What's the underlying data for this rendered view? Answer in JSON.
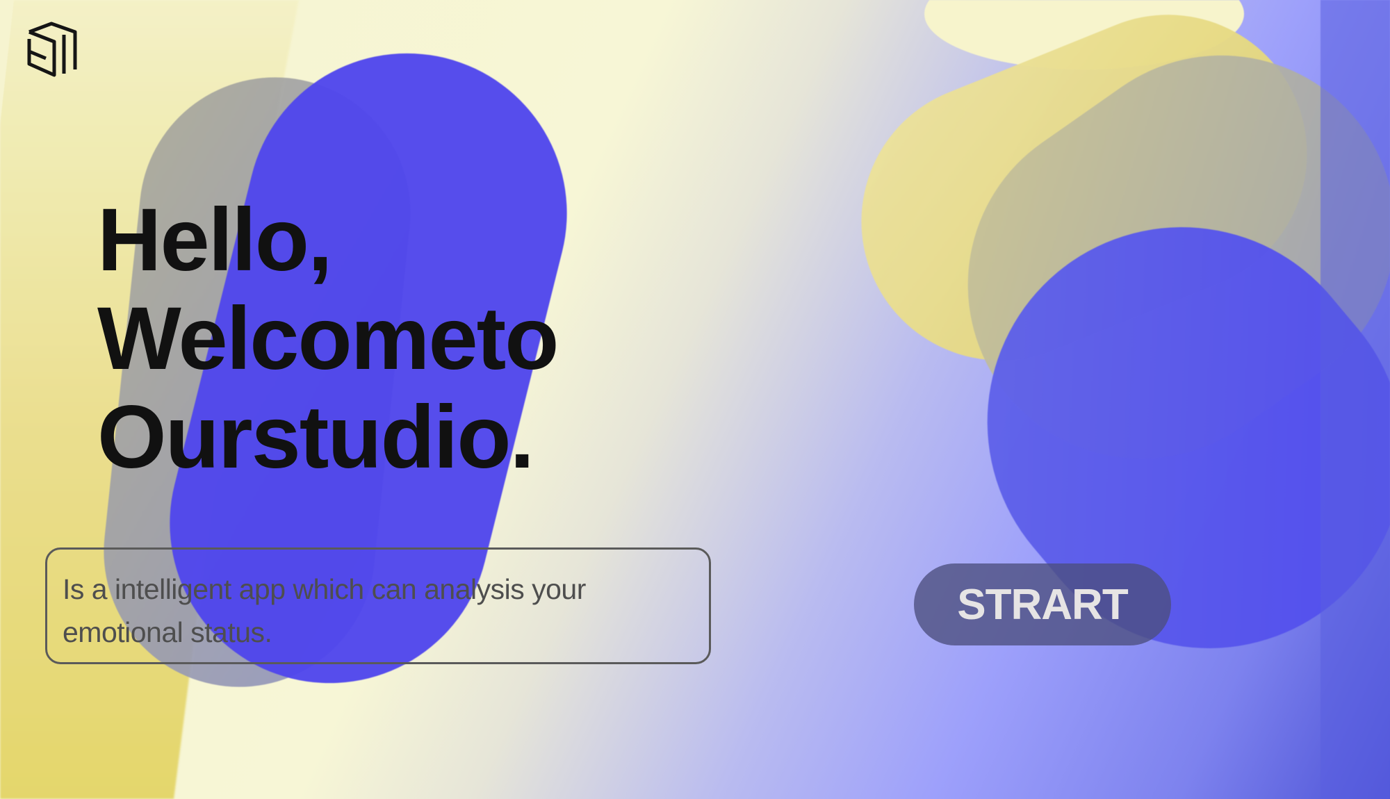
{
  "brand": {
    "logo_icon": "stacked-frame-logo-icon"
  },
  "hero": {
    "headline_line1": "Hello,",
    "headline_line2": "Welcometo",
    "headline_line3": "Ourstudio."
  },
  "description": {
    "text": "Is a intelligent app which can analysis your emotional status."
  },
  "cta": {
    "start_label": "STRART"
  },
  "colors": {
    "background_yellow": "#f6f4d0",
    "blob_blue": "#5147ec",
    "blob_yellow": "#e8dc84",
    "blob_gray": "#a6a79c",
    "text_dark": "#111111",
    "button_bg": "#4b4e7d",
    "button_text": "#e6e4e4"
  }
}
